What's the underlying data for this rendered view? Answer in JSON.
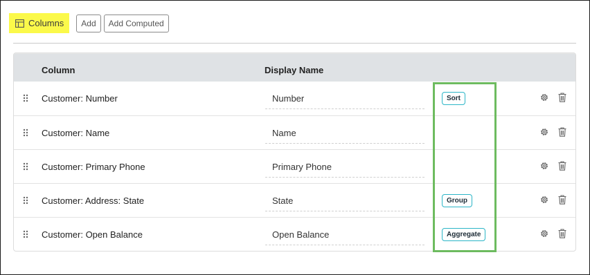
{
  "toolbar": {
    "columns_label": "Columns",
    "add_label": "Add",
    "add_computed_label": "Add Computed"
  },
  "table": {
    "headers": {
      "column": "Column",
      "display_name": "Display Name"
    },
    "rows": [
      {
        "column": "Customer: Number",
        "display_name": "Number",
        "tag": "Sort"
      },
      {
        "column": "Customer: Name",
        "display_name": "Name",
        "tag": ""
      },
      {
        "column": "Customer: Primary Phone",
        "display_name": "Primary Phone",
        "tag": ""
      },
      {
        "column": "Customer: Address: State",
        "display_name": "State",
        "tag": "Group"
      },
      {
        "column": "Customer: Open Balance",
        "display_name": "Open Balance",
        "tag": "Aggregate"
      }
    ]
  },
  "icons": {
    "columns": "table-columns-icon",
    "drag": "drag-handle-icon",
    "settings": "gear-icon",
    "delete": "trash-icon"
  },
  "colors": {
    "highlight_yellow": "#fbf94a",
    "header_bg": "#dfe2e5",
    "tag_border": "#2bb5c7",
    "annotation_green": "#6dbb5f"
  }
}
